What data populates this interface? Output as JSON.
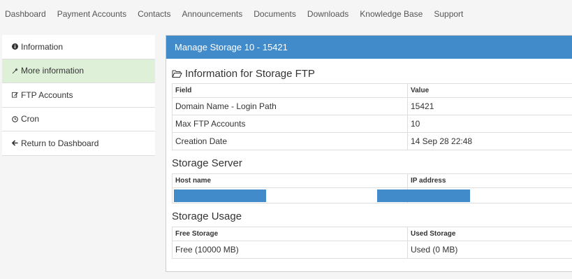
{
  "nav": {
    "items": [
      "Dashboard",
      "Payment Accounts",
      "Contacts",
      "Announcements",
      "Documents",
      "Downloads",
      "Knowledge Base",
      "Support"
    ]
  },
  "sidebar": {
    "items": [
      {
        "label": "Information",
        "icon": "info-icon"
      },
      {
        "label": "More information",
        "icon": "wrench-icon"
      },
      {
        "label": "FTP Accounts",
        "icon": "edit-icon"
      },
      {
        "label": "Cron",
        "icon": "clock-icon"
      },
      {
        "label": "Return to Dashboard",
        "icon": "arrow-left-icon"
      }
    ]
  },
  "panel": {
    "title": "Manage Storage 10 - 15421",
    "info_title": "Information for Storage FTP",
    "info_table": {
      "headers": [
        "Field",
        "Value"
      ],
      "rows": [
        [
          "Domain Name - Login Path",
          "15421"
        ],
        [
          "Max FTP Accounts",
          "10"
        ],
        [
          "Creation Date",
          "14 Sep 28 22:48"
        ]
      ]
    },
    "server_title": "Storage Server",
    "server_table": {
      "headers": [
        "Host name",
        "IP address"
      ]
    },
    "usage_title": "Storage Usage",
    "usage_table": {
      "headers": [
        "Free Storage",
        "Used Storage"
      ],
      "rows": [
        [
          "Free (10000 MB)",
          "Used (0 MB)"
        ]
      ]
    }
  },
  "colors": {
    "accent": "#428bca",
    "active_bg": "#dff0d8"
  }
}
